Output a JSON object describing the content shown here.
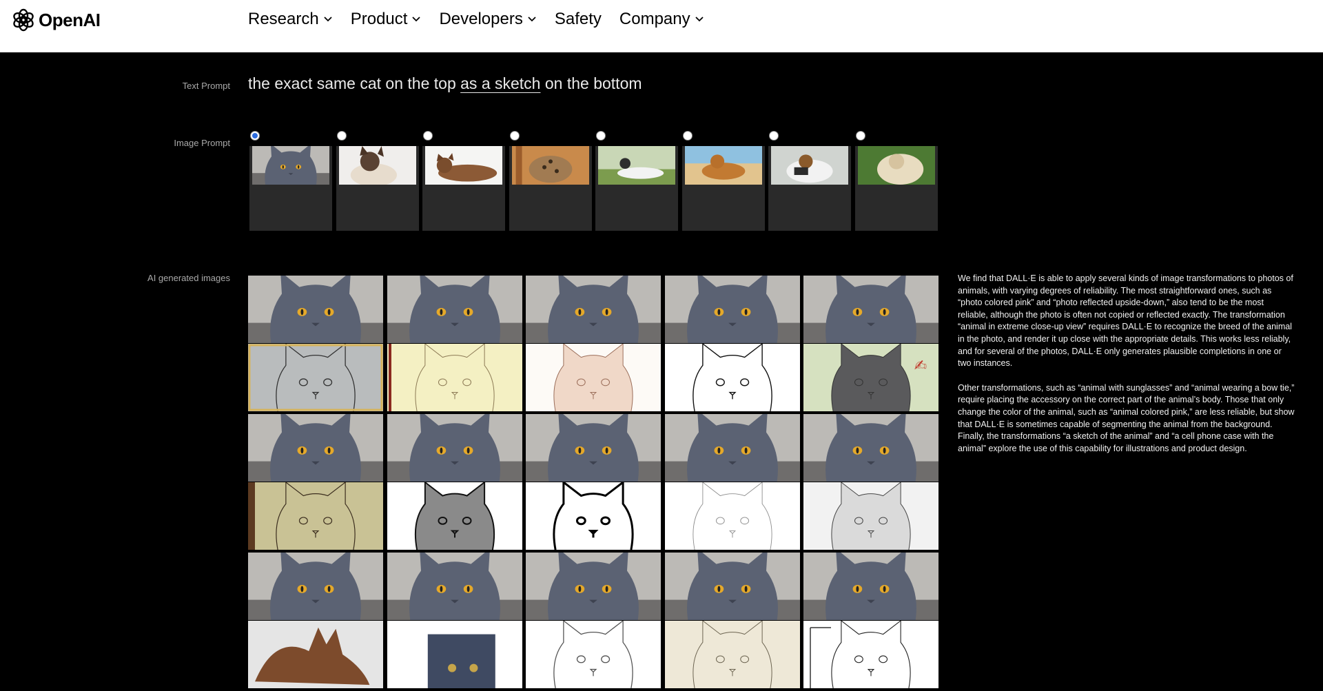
{
  "header": {
    "brand": "OpenAI",
    "nav": [
      {
        "label": "Research",
        "dropdown": true
      },
      {
        "label": "Product",
        "dropdown": true
      },
      {
        "label": "Developers",
        "dropdown": true
      },
      {
        "label": "Safety",
        "dropdown": false
      },
      {
        "label": "Company",
        "dropdown": true
      }
    ]
  },
  "labels": {
    "text_prompt": "Text Prompt",
    "image_prompt": "Image Prompt",
    "ai_generated": "AI generated images"
  },
  "prompt": {
    "before": "the exact same cat on the top ",
    "link": "as a sketch",
    "after": " on the bottom"
  },
  "image_prompt_options": [
    {
      "icon": "grey-cat",
      "selected": true
    },
    {
      "icon": "siamese-cat",
      "selected": false
    },
    {
      "icon": "tabby-cat-lying",
      "selected": false
    },
    {
      "icon": "bengal-cat",
      "selected": false
    },
    {
      "icon": "whippet-dog",
      "selected": false
    },
    {
      "icon": "golden-dog-beach",
      "selected": false
    },
    {
      "icon": "terrier-dog",
      "selected": false
    },
    {
      "icon": "shih-tzu-dog",
      "selected": false
    }
  ],
  "generated_sketch_styles": [
    "grey-pencil",
    "yellow-pencil",
    "watercolor",
    "line-outline",
    "green-painted",
    "khaki-doodle",
    "ink-crosshatch",
    "bold-outline",
    "faint-pencil",
    "grey-shaded",
    "brown-clay",
    "dark-photo",
    "soft-outline",
    "beige-minimal",
    "simple-outline"
  ],
  "description": [
    "We find that DALL·E is able to apply several kinds of image transformations to photos of animals, with varying degrees of reliability. The most straightforward ones, such as “photo colored pink” and “photo reflected upside-down,” also tend to be the most reliable, although the photo is often not copied or reflected exactly. The transformation “animal in extreme close-up view” requires DALL·E to recognize the breed of the animal in the photo, and render it up close with the appropriate details. This works less reliably, and for several of the photos, DALL·E only generates plausible completions in one or two instances.",
    "Other transformations, such as “animal with sunglasses” and “animal wearing a bow tie,” require placing the accessory on the correct part of the animal’s body. Those that only change the color of the animal, such as “animal colored pink,” are less reliable, but show that DALL·E is sometimes capable of segmenting the animal from the background. Finally, the transformations “a sketch of the animal” and “a cell phone case with the animal” explore the use of this capability for illustrations and product design."
  ],
  "colors": {
    "accent_radio": "#2d6cdf",
    "background": "#000000",
    "header": "#ffffff"
  }
}
